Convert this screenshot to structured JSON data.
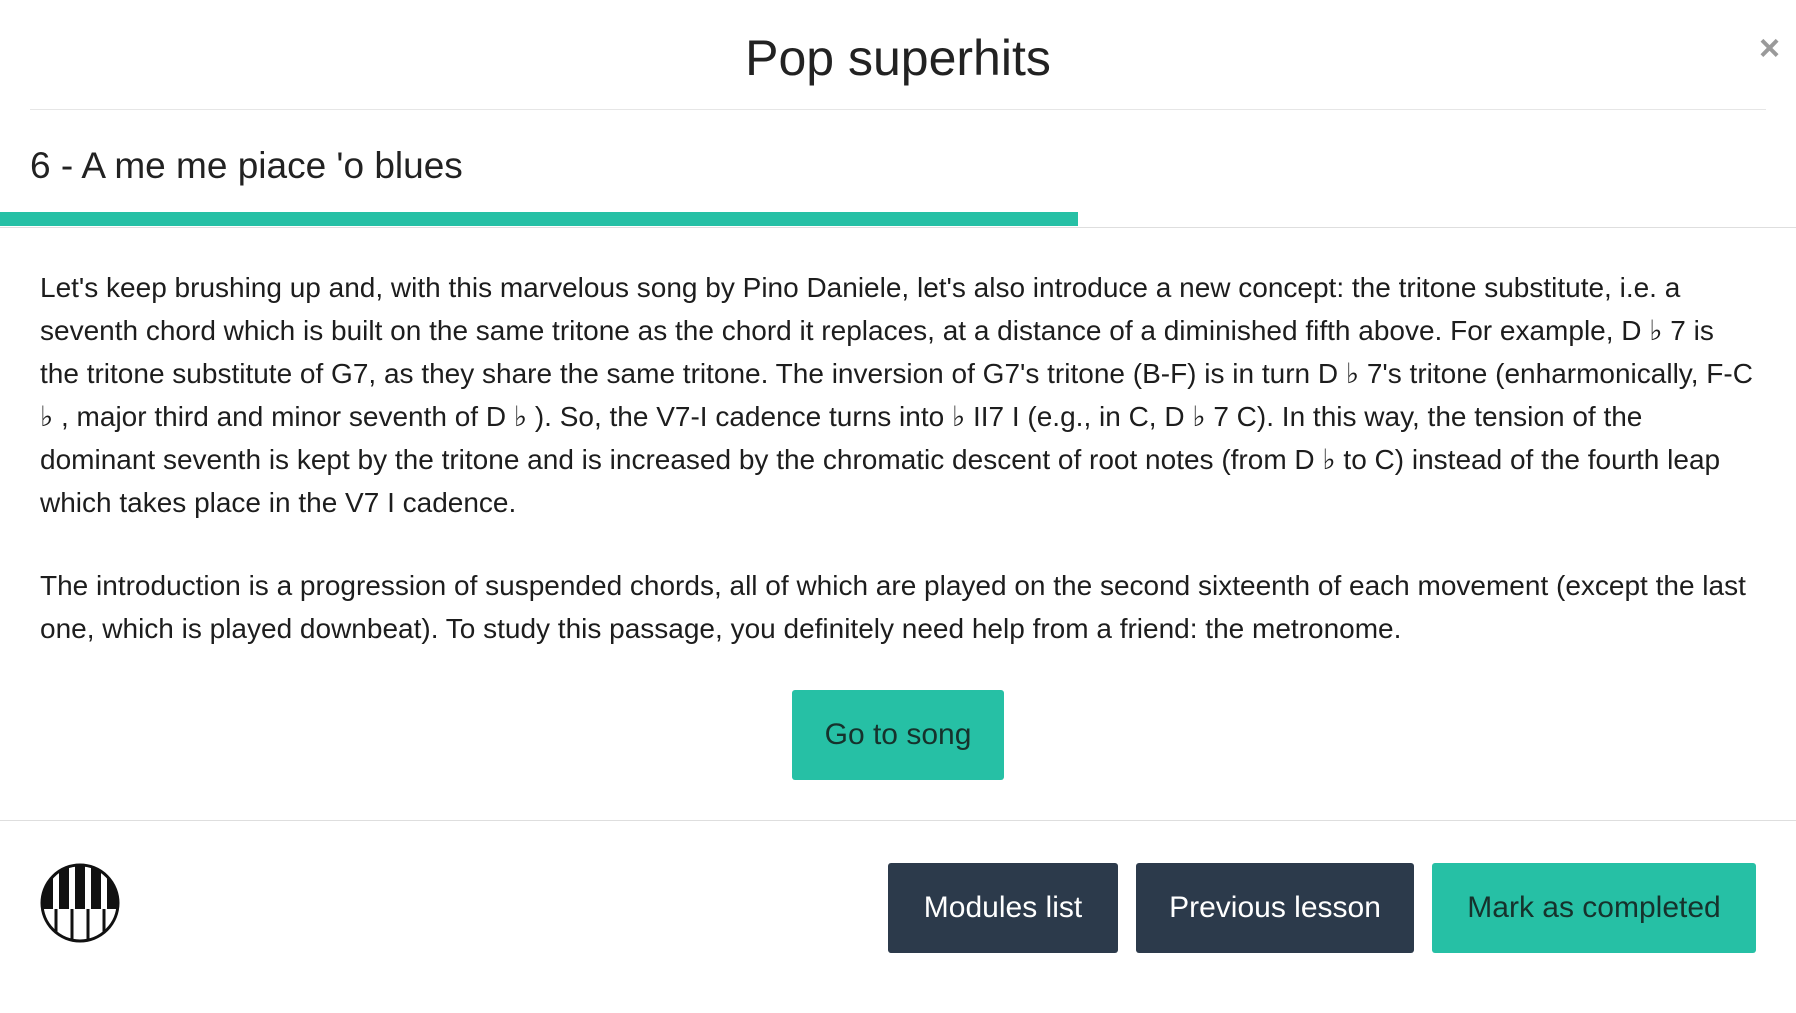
{
  "header": {
    "title": "Pop superhits",
    "close_label": "×"
  },
  "lesson": {
    "title": "6 - A me me piace 'o blues",
    "progress_percent": 60
  },
  "content": {
    "paragraphs": [
      "Let's keep brushing up and, with this marvelous song by Pino Daniele, let's also introduce a new concept: the tritone substitute, i.e. a seventh chord which is built on the same tritone as the chord it replaces, at a distance of a diminished fifth above. For example, D ♭ 7 is the tritone substitute of G7, as they share the same tritone. The inversion of G7's tritone (B-F) is in turn D ♭ 7's tritone (enharmonically, F-C ♭ , major third and minor seventh of D ♭ ). So, the V7-I cadence turns into  ♭ II7 I (e.g., in C, D ♭ 7 C). In this way, the tension of the dominant seventh is kept by the tritone and is increased by the chromatic descent of root notes (from D ♭  to C) instead of the fourth leap which takes place in the V7 I cadence.",
      "The introduction is a progression of suspended chords, all of which are played on the second sixteenth of each movement (except the last one, which is played downbeat). To study this passage, you definitely need help from a friend: the metronome."
    ],
    "go_button": "Go to song"
  },
  "footer": {
    "logo_icon": "piano-keys-icon",
    "modules_button": "Modules list",
    "previous_button": "Previous lesson",
    "complete_button": "Mark as completed"
  },
  "colors": {
    "accent": "#26c0a5",
    "dark_button": "#2c3a4b"
  }
}
